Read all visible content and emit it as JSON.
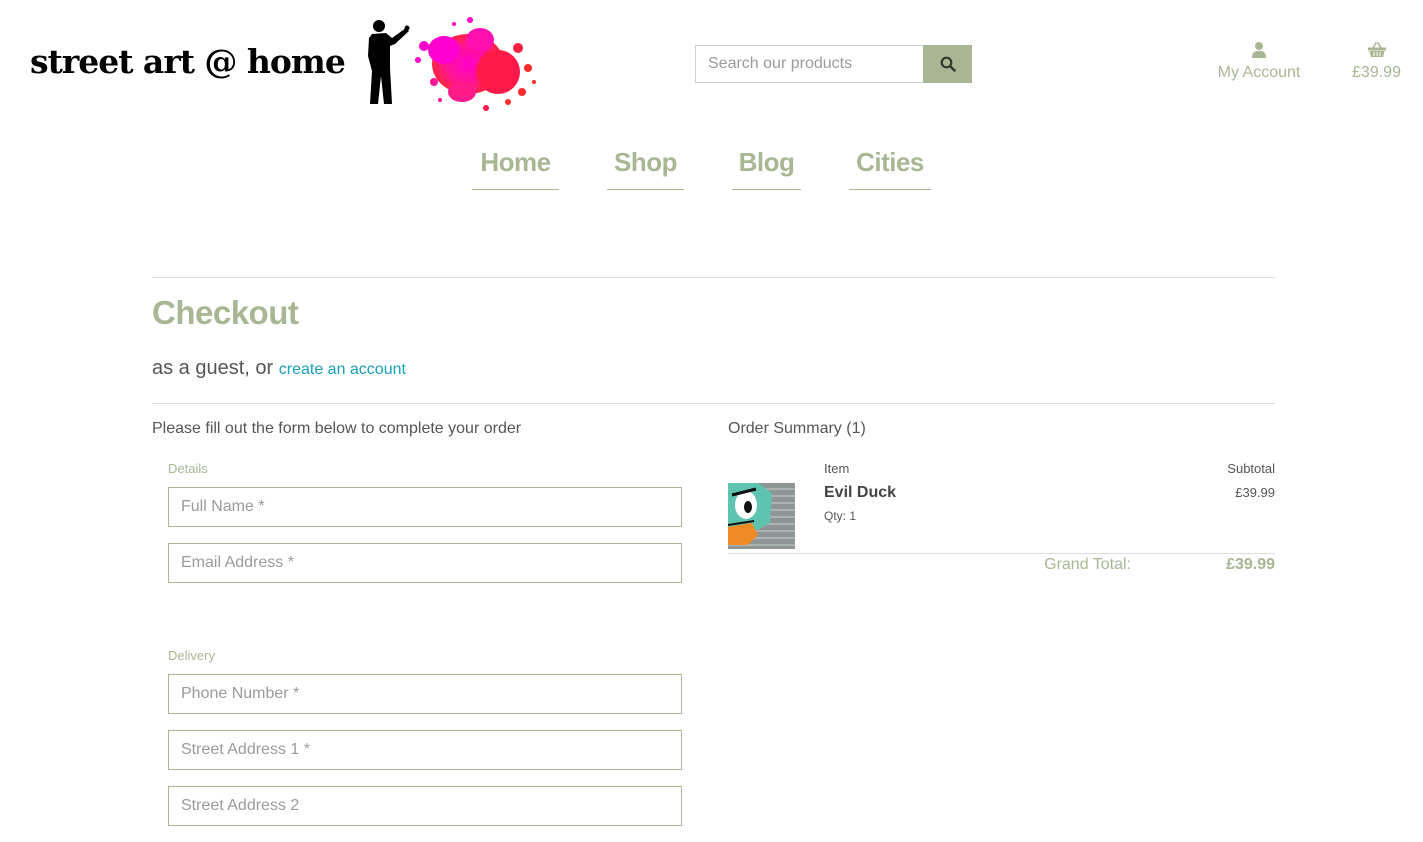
{
  "header": {
    "brand_text": "street art @ home",
    "search": {
      "placeholder": "Search our products"
    },
    "account_label": "My Account",
    "basket_total": "£39.99"
  },
  "nav": {
    "items": [
      {
        "label": "Home"
      },
      {
        "label": "Shop"
      },
      {
        "label": "Blog"
      },
      {
        "label": "Cities"
      }
    ]
  },
  "checkout": {
    "title": "Checkout",
    "subtitle_prefix": "as a guest, or",
    "create_account_link": "create an account",
    "form_intro": "Please fill out the form below to complete your order",
    "details_legend": "Details",
    "delivery_legend": "Delivery",
    "fields": {
      "full_name": "Full Name *",
      "email": "Email Address *",
      "phone": "Phone Number *",
      "street1": "Street Address 1 *",
      "street2": "Street Address 2"
    }
  },
  "summary": {
    "title": "Order Summary (1)",
    "col_item": "Item",
    "col_subtotal": "Subtotal",
    "items": [
      {
        "name": "Evil Duck",
        "qty": "Qty: 1",
        "subtotal": "£39.99"
      }
    ],
    "grand_total_label": "Grand Total:",
    "grand_total_value": "£39.99"
  },
  "colors": {
    "accent": "#a9b693",
    "link": "#17a2b8",
    "text": "#555555"
  },
  "icons": {
    "search": "search-icon",
    "account": "user-icon",
    "basket": "basket-icon"
  }
}
